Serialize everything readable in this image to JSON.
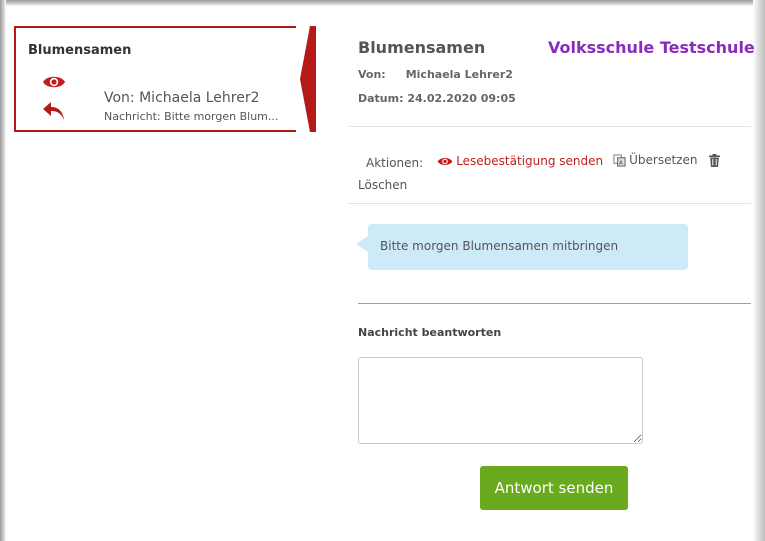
{
  "colors": {
    "accent_red": "#b41a1a",
    "school_purple": "#8a2bbf",
    "bubble_blue": "#cdeaf8",
    "button_green": "#6aaa1e"
  },
  "message_list": {
    "item": {
      "title": "Blumensamen",
      "from": "Von: Michaela Lehrer2",
      "preview": "Nachricht: Bitte morgen Blum...",
      "icons": [
        "eye-icon",
        "reply-icon"
      ]
    }
  },
  "detail": {
    "subject": "Blumensamen",
    "school": "Volksschule Testschule",
    "from_label": "Von:",
    "from_name": "Michaela Lehrer2",
    "date_text": "Datum: 24.02.2020 09:05",
    "actions": {
      "label": "Aktionen:",
      "read_receipt": "Lesebestätigung senden",
      "translate": "Übersetzen",
      "delete": "Löschen"
    },
    "message_body": "Bitte morgen Blumensamen mitbringen"
  },
  "reply": {
    "label": "Nachricht beantworten",
    "value": "",
    "send_button": "Antwort senden"
  }
}
